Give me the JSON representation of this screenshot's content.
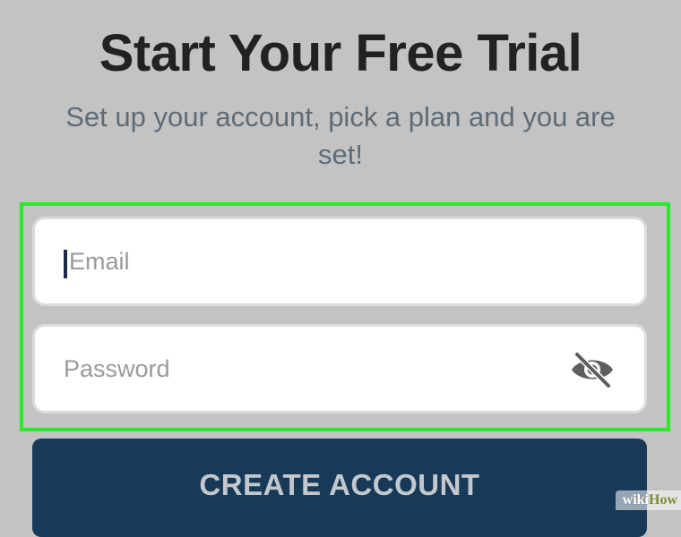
{
  "header": {
    "title": "Start Your Free Trial",
    "subtitle": "Set up your account, pick a plan and you are set!"
  },
  "form": {
    "email": {
      "placeholder": "Email",
      "value": ""
    },
    "password": {
      "placeholder": "Password",
      "value": "",
      "visibility_icon": "eye-slash-icon"
    }
  },
  "actions": {
    "create_account_label": "CREATE ACCOUNT"
  },
  "watermark": {
    "part1": "wiki",
    "part2": "How"
  },
  "colors": {
    "highlight": "#2ee82e",
    "button_bg": "#173a59",
    "background": "#c3c3c3"
  }
}
